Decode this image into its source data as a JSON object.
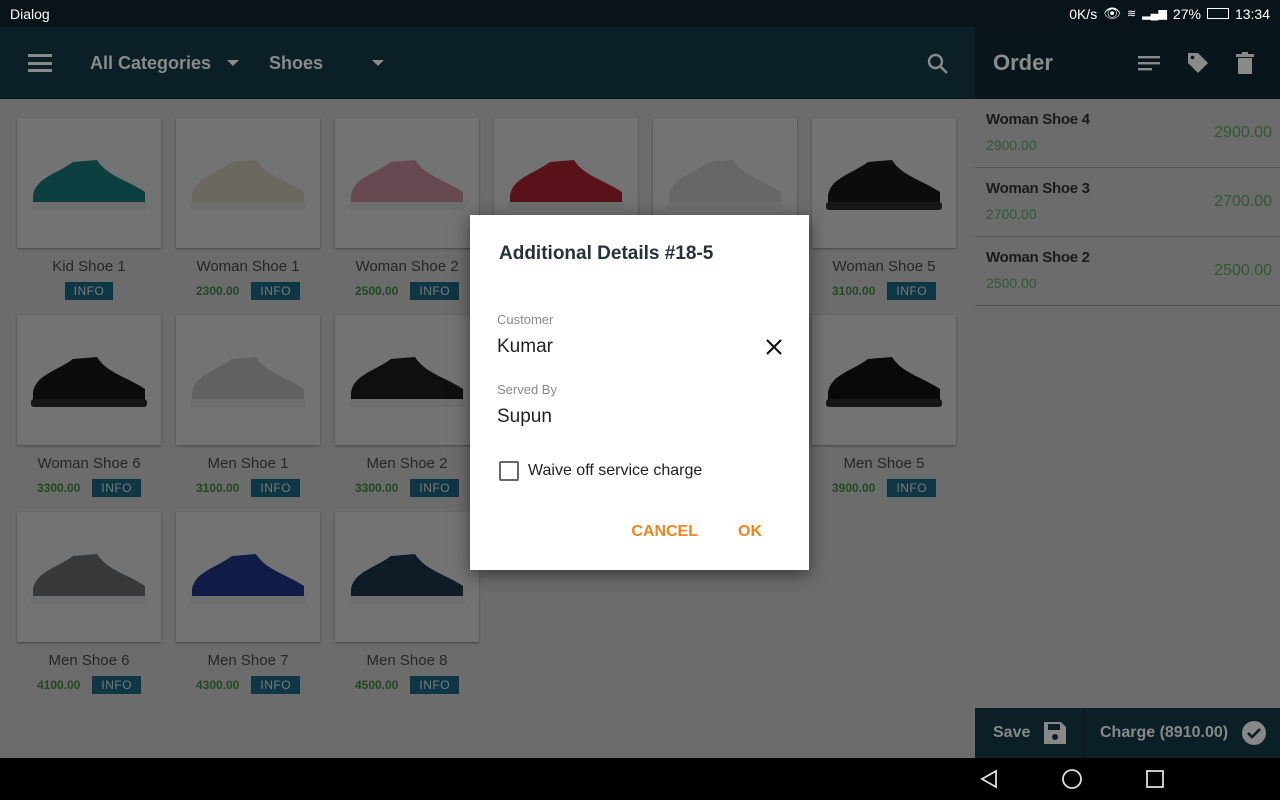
{
  "status_bar": {
    "app": "Dialog",
    "speed": "0K/s",
    "battery": "27%",
    "time": "13:34"
  },
  "toolbar": {
    "category": "All Categories",
    "subcategory": "Shoes"
  },
  "products": [
    {
      "name": "Kid Shoe 1",
      "price": "",
      "color": "#1a8a8f",
      "info": "INFO"
    },
    {
      "name": "Woman Shoe 1",
      "price": "2300.00",
      "color": "#eee8d5",
      "info": "INFO"
    },
    {
      "name": "Woman Shoe 2",
      "price": "2500.00",
      "color": "#e9a2b3",
      "info": "INFO"
    },
    {
      "name": "",
      "price": "",
      "color": "#c8283a",
      "info": ""
    },
    {
      "name": "",
      "price": "",
      "color": "#e4e4e8",
      "info": ""
    },
    {
      "name": "Woman Shoe 5",
      "price": "3100.00",
      "color": "#1a1a1a",
      "info": "INFO"
    },
    {
      "name": "Woman Shoe 6",
      "price": "3300.00",
      "color": "#1a1a1a",
      "info": "INFO"
    },
    {
      "name": "Men Shoe 1",
      "price": "3100.00",
      "color": "#d8d8d8",
      "info": "INFO"
    },
    {
      "name": "Men Shoe 2",
      "price": "3300.00",
      "color": "#222222",
      "info": "INFO"
    },
    {
      "name": "",
      "price": "",
      "color": "#444444",
      "info": ""
    },
    {
      "name": "",
      "price": "",
      "color": "#444444",
      "info": ""
    },
    {
      "name": "Men Shoe 5",
      "price": "3900.00",
      "color": "#151515",
      "info": "INFO"
    },
    {
      "name": "Men Shoe 6",
      "price": "4100.00",
      "color": "#7a7d80",
      "info": "INFO"
    },
    {
      "name": "Men Shoe 7",
      "price": "4300.00",
      "color": "#233f9a",
      "info": "INFO"
    },
    {
      "name": "Men Shoe 8",
      "price": "4500.00",
      "color": "#243b5a",
      "info": "INFO"
    }
  ],
  "order": {
    "title": "Order",
    "items": [
      {
        "name": "Woman Shoe 4",
        "unit": "2900.00",
        "total": "2900.00"
      },
      {
        "name": "Woman Shoe 3",
        "unit": "2700.00",
        "total": "2700.00"
      },
      {
        "name": "Woman Shoe 2",
        "unit": "2500.00",
        "total": "2500.00"
      }
    ],
    "save": "Save",
    "charge": "Charge (8910.00)"
  },
  "dialog": {
    "title": "Additional Details #18-5",
    "customer_label": "Customer",
    "customer": "Kumar",
    "served_label": "Served By",
    "served": "Supun",
    "waive": "Waive off service charge",
    "waive_checked": false,
    "cancel": "CANCEL",
    "ok": "OK"
  },
  "colors": {
    "toolbar": "#184557",
    "accent": "#f0841f",
    "price": "#2e7d32",
    "info": "#1f6f8b"
  }
}
